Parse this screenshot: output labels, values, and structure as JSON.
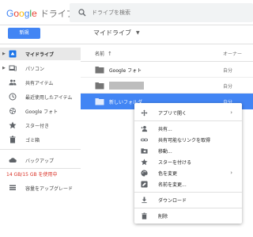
{
  "header": {
    "logo_letters": [
      "G",
      "o",
      "o",
      "g",
      "l",
      "e"
    ],
    "product": "ドライブ",
    "search_placeholder": "ドライブを検索"
  },
  "toolbar": {
    "new_label": "新規",
    "breadcrumb": "マイドライブ"
  },
  "sidebar": {
    "items": [
      {
        "label": "マイドライブ",
        "icon": "drive-icon",
        "active": true
      },
      {
        "label": "パソコン",
        "icon": "computer-icon"
      },
      {
        "label": "共有アイテム",
        "icon": "people-icon"
      },
      {
        "label": "最近使用したアイテム",
        "icon": "clock-icon"
      },
      {
        "label": "Google フォト",
        "icon": "pinwheel-icon"
      },
      {
        "label": "スター付き",
        "icon": "star-icon"
      },
      {
        "label": "ゴミ箱",
        "icon": "trash-icon"
      },
      {
        "label": "バックアップ",
        "icon": "cloud-icon"
      }
    ],
    "storage_text": "14 GB/15 GB を使用中",
    "upgrade_label": "容量をアップグレード"
  },
  "file_list": {
    "col_name": "名前",
    "col_owner": "オーナー",
    "rows": [
      {
        "name": "Google フォト",
        "owner": "自分"
      },
      {
        "name": "",
        "owner": "自分",
        "redacted": true
      },
      {
        "name": "新しいフォルダ",
        "owner": "自分",
        "selected": true
      }
    ]
  },
  "context_menu": {
    "items": [
      {
        "label": "アプリで開く",
        "icon": "open-with-icon",
        "submenu": true
      },
      {
        "label": "共有...",
        "icon": "person-add-icon"
      },
      {
        "label": "共有可能なリンクを取得",
        "icon": "link-icon"
      },
      {
        "label": "移動...",
        "icon": "move-folder-icon"
      },
      {
        "label": "スターを付ける",
        "icon": "star-icon"
      },
      {
        "label": "色を変更",
        "icon": "palette-icon",
        "submenu": true
      },
      {
        "label": "名前を変更...",
        "icon": "edit-icon"
      },
      {
        "label": "ダウンロード",
        "icon": "download-icon"
      },
      {
        "label": "削除",
        "icon": "trash-icon"
      }
    ]
  },
  "colors": {
    "accent": "#4285f4",
    "storage_warning": "#d93025"
  }
}
